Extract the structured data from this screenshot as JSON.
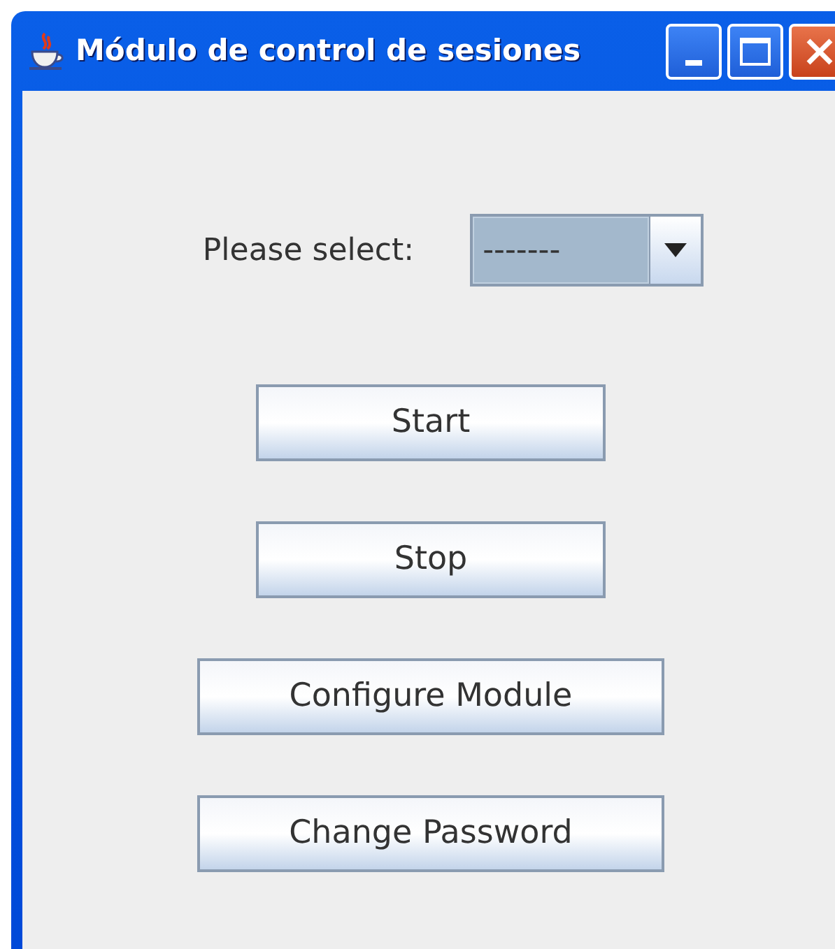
{
  "window": {
    "title": "Módulo de control de sesiones"
  },
  "select": {
    "label": "Please select:",
    "value": "-------"
  },
  "buttons": [
    {
      "label": "Start",
      "kind": "narrow"
    },
    {
      "label": "Stop",
      "kind": "narrow"
    },
    {
      "label": "Configure Module",
      "kind": "wide"
    },
    {
      "label": "Change Password",
      "kind": "wide"
    }
  ]
}
